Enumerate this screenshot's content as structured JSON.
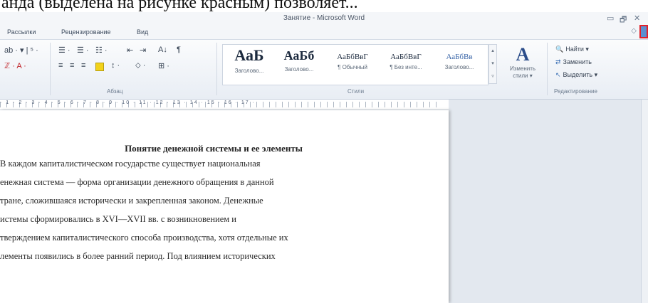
{
  "question_text": "анда (выделена на рисунке красным) позволяет...",
  "window": {
    "title": "Занятие - Microsoft Word",
    "controls": [
      "▭",
      "🗗",
      "✕"
    ]
  },
  "menu": {
    "items": [
      "Рассылки",
      "Рецензирование",
      "Вид"
    ],
    "help_glyph": "◇"
  },
  "ribbon": {
    "font_tools_row1": "ab ·  ▾ | ⁵ ·",
    "font_tools_row2": "ℤ ·  A ·",
    "para_row1": [
      "☰ ·",
      "☰ ·",
      "☷ ·",
      "⇤",
      "⇥",
      "A↓",
      "¶"
    ],
    "para_row2": [
      "≡",
      "≡",
      "≡",
      "",
      "↕ ·",
      "⬦ ·",
      "⊞ ·"
    ],
    "paragraph_group": "Абзац",
    "styles_group": "Стили",
    "editing_group": "Редактирование",
    "styles": [
      {
        "sample": "АаБ",
        "name": "Заголово..."
      },
      {
        "sample": "АаБб",
        "name": "Заголово..."
      },
      {
        "sample": "АаБбВвГ",
        "name": "¶ Обычный"
      },
      {
        "sample": "АаБбВвГ",
        "name": "¶ Без инте..."
      },
      {
        "sample": "АаБбВв",
        "name": "Заголово..."
      }
    ],
    "change_styles": {
      "glyph": "A",
      "label_line1": "Изменить",
      "label_line2": "стили ▾"
    },
    "editing": [
      {
        "icon": "🔍",
        "label": "Найти ▾"
      },
      {
        "icon": "⇄",
        "label": "Заменить"
      },
      {
        "icon": "↖",
        "label": "Выделить ▾"
      }
    ]
  },
  "ruler": {
    "numbers": "· 1 · 2 · 3 · 4 · 5 · 6 · 7 · 8 · 9 · 10 · 11 · 12 · 13 · 14 · 15 · 16 · 17 ·"
  },
  "document": {
    "heading": "Понятие денежной системы и ее элементы",
    "lines": [
      "    В каждом капиталистическом государстве существует национальная",
      "енежная система — форма организации денежного обращения в данной",
      "тране, сложившаяся исторически и закрепленная законом. Денежные",
      "истемы сформировались в XVI—XVII вв. с возникновением и",
      "тверждением капиталистического способа производства, хотя отдельные их",
      "лементы появились в более ранний период. Под влиянием исторических"
    ]
  }
}
